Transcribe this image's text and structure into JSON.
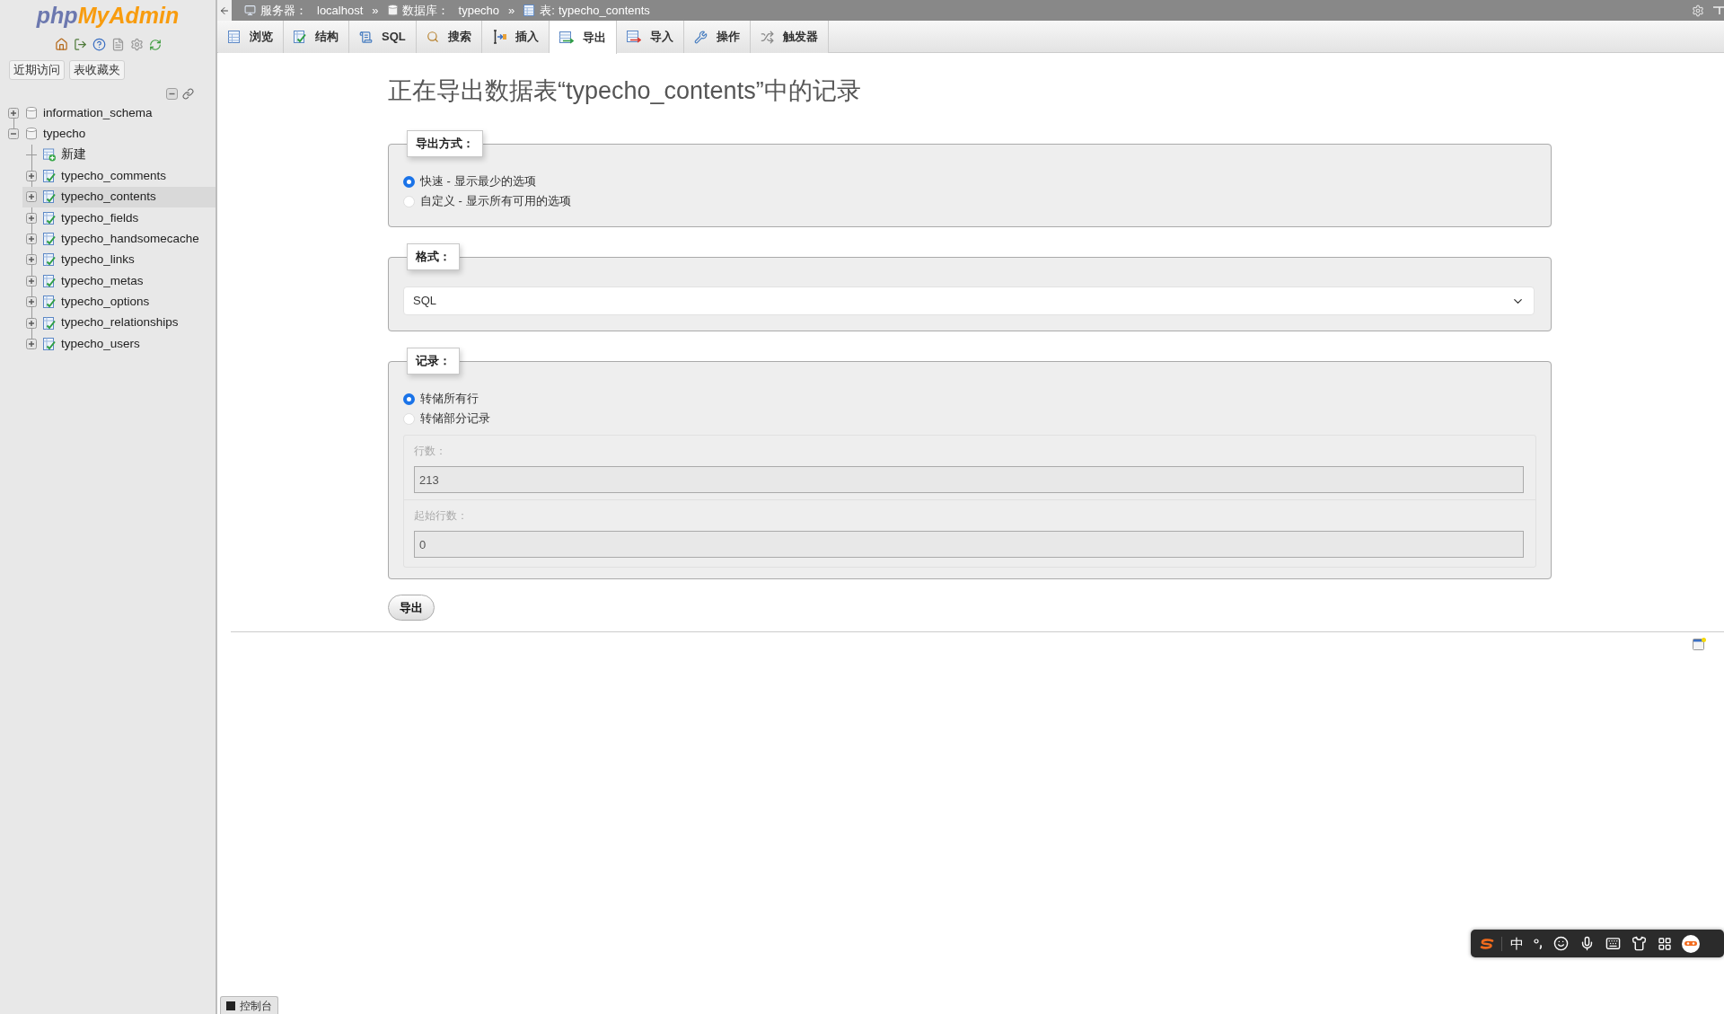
{
  "sidebar": {
    "logo": {
      "prefix": "php",
      "name": "MyAdmin"
    },
    "buttons": [
      "近期访问",
      "表收藏夹"
    ],
    "tree": [
      {
        "kind": "database",
        "label": "information_schema",
        "expanded": false,
        "selected": false
      },
      {
        "kind": "database",
        "label": "typecho",
        "expanded": true,
        "selected": false,
        "children": [
          {
            "kind": "new",
            "label": "新建",
            "selected": false
          },
          {
            "kind": "table",
            "label": "typecho_comments",
            "expanded": false,
            "selected": false
          },
          {
            "kind": "table",
            "label": "typecho_contents",
            "expanded": false,
            "selected": true
          },
          {
            "kind": "table",
            "label": "typecho_fields",
            "expanded": false,
            "selected": false
          },
          {
            "kind": "table",
            "label": "typecho_handsomecache",
            "expanded": false,
            "selected": false
          },
          {
            "kind": "table",
            "label": "typecho_links",
            "expanded": false,
            "selected": false
          },
          {
            "kind": "table",
            "label": "typecho_metas",
            "expanded": false,
            "selected": false
          },
          {
            "kind": "table",
            "label": "typecho_options",
            "expanded": false,
            "selected": false
          },
          {
            "kind": "table",
            "label": "typecho_relationships",
            "expanded": false,
            "selected": false
          },
          {
            "kind": "table",
            "label": "typecho_users",
            "expanded": false,
            "selected": false
          }
        ]
      }
    ]
  },
  "breadcrumb": [
    {
      "kind": "server",
      "label": "服务器：",
      "value": "localhost"
    },
    {
      "kind": "database",
      "separator": "»",
      "label": "数据库：",
      "value": "typecho"
    },
    {
      "kind": "table",
      "separator": "»",
      "label": "表:",
      "value": "typecho_contents"
    }
  ],
  "tabs": [
    {
      "label": "浏览",
      "selected": false
    },
    {
      "label": "结构",
      "selected": false
    },
    {
      "label": "SQL",
      "selected": false
    },
    {
      "label": "搜索",
      "selected": false
    },
    {
      "label": "插入",
      "selected": false
    },
    {
      "label": "导出",
      "selected": true
    },
    {
      "label": "导入",
      "selected": false
    },
    {
      "label": "操作",
      "selected": false
    },
    {
      "label": "触发器",
      "selected": false
    }
  ],
  "title": "正在导出数据表“typecho_contents”中的记录",
  "export_method": {
    "legend": "导出方式：",
    "options": [
      {
        "label": "快速 - 显示最少的选项",
        "selected": true
      },
      {
        "label": "自定义 - 显示所有可用的选项",
        "selected": false
      }
    ]
  },
  "format": {
    "legend": "格式：",
    "value": "SQL"
  },
  "records": {
    "legend": "记录：",
    "options": [
      {
        "label": "转储所有行",
        "selected": true
      },
      {
        "label": "转储部分记录",
        "selected": false
      }
    ],
    "fields": [
      {
        "label": "行数：",
        "value": "213",
        "disabled": true
      },
      {
        "label": "起始行数：",
        "value": "0",
        "disabled": true
      }
    ]
  },
  "submit_button": "导出",
  "console": "控制台",
  "input_method_bar": {
    "mode": "中"
  }
}
